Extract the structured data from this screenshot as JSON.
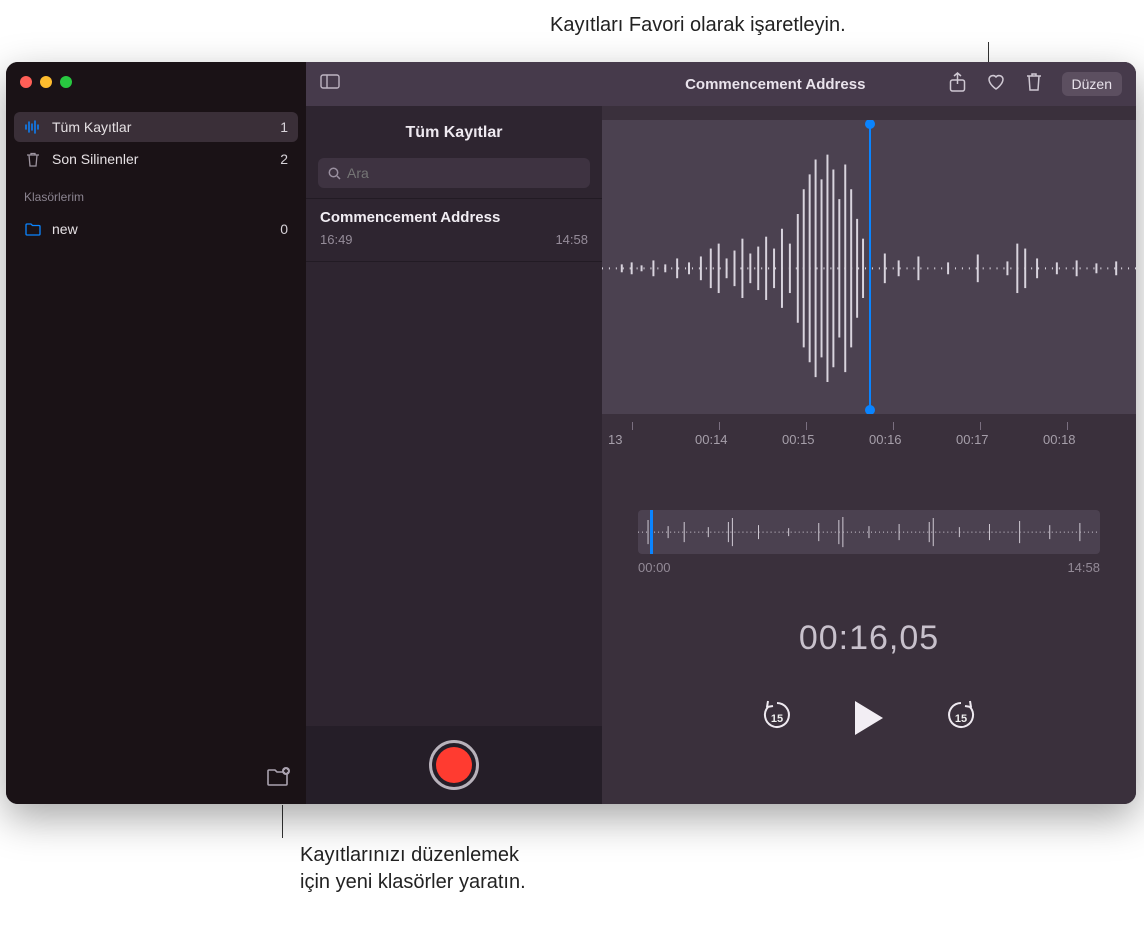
{
  "callouts": {
    "top": "Kayıtları Favori olarak işaretleyin.",
    "bottom1": "Kayıtlarınızı düzenlemek",
    "bottom2": "için yeni klasörler yaratın."
  },
  "sidebar": {
    "items": [
      {
        "label": "Tüm Kayıtlar",
        "count": "1",
        "icon": "waveform-icon",
        "active": true
      },
      {
        "label": "Son Silinenler",
        "count": "2",
        "icon": "trash-icon",
        "active": false
      }
    ],
    "section_label": "Klasörlerim",
    "folders": [
      {
        "label": "new",
        "count": "0"
      }
    ]
  },
  "listpanel": {
    "header": "Tüm Kayıtlar",
    "search_placeholder": "Ara",
    "recordings": [
      {
        "title": "Commencement Address",
        "time": "16:49",
        "duration": "14:58"
      }
    ]
  },
  "toolbar": {
    "title": "Commencement Address",
    "edit_label": "Düzen"
  },
  "detail": {
    "ruler": [
      "13",
      "00:14",
      "00:15",
      "00:16",
      "00:17",
      "00:18"
    ],
    "overview_start": "00:00",
    "overview_end": "14:58",
    "timestamp": "00:16,05",
    "skip_back": "15",
    "skip_fwd": "15"
  }
}
